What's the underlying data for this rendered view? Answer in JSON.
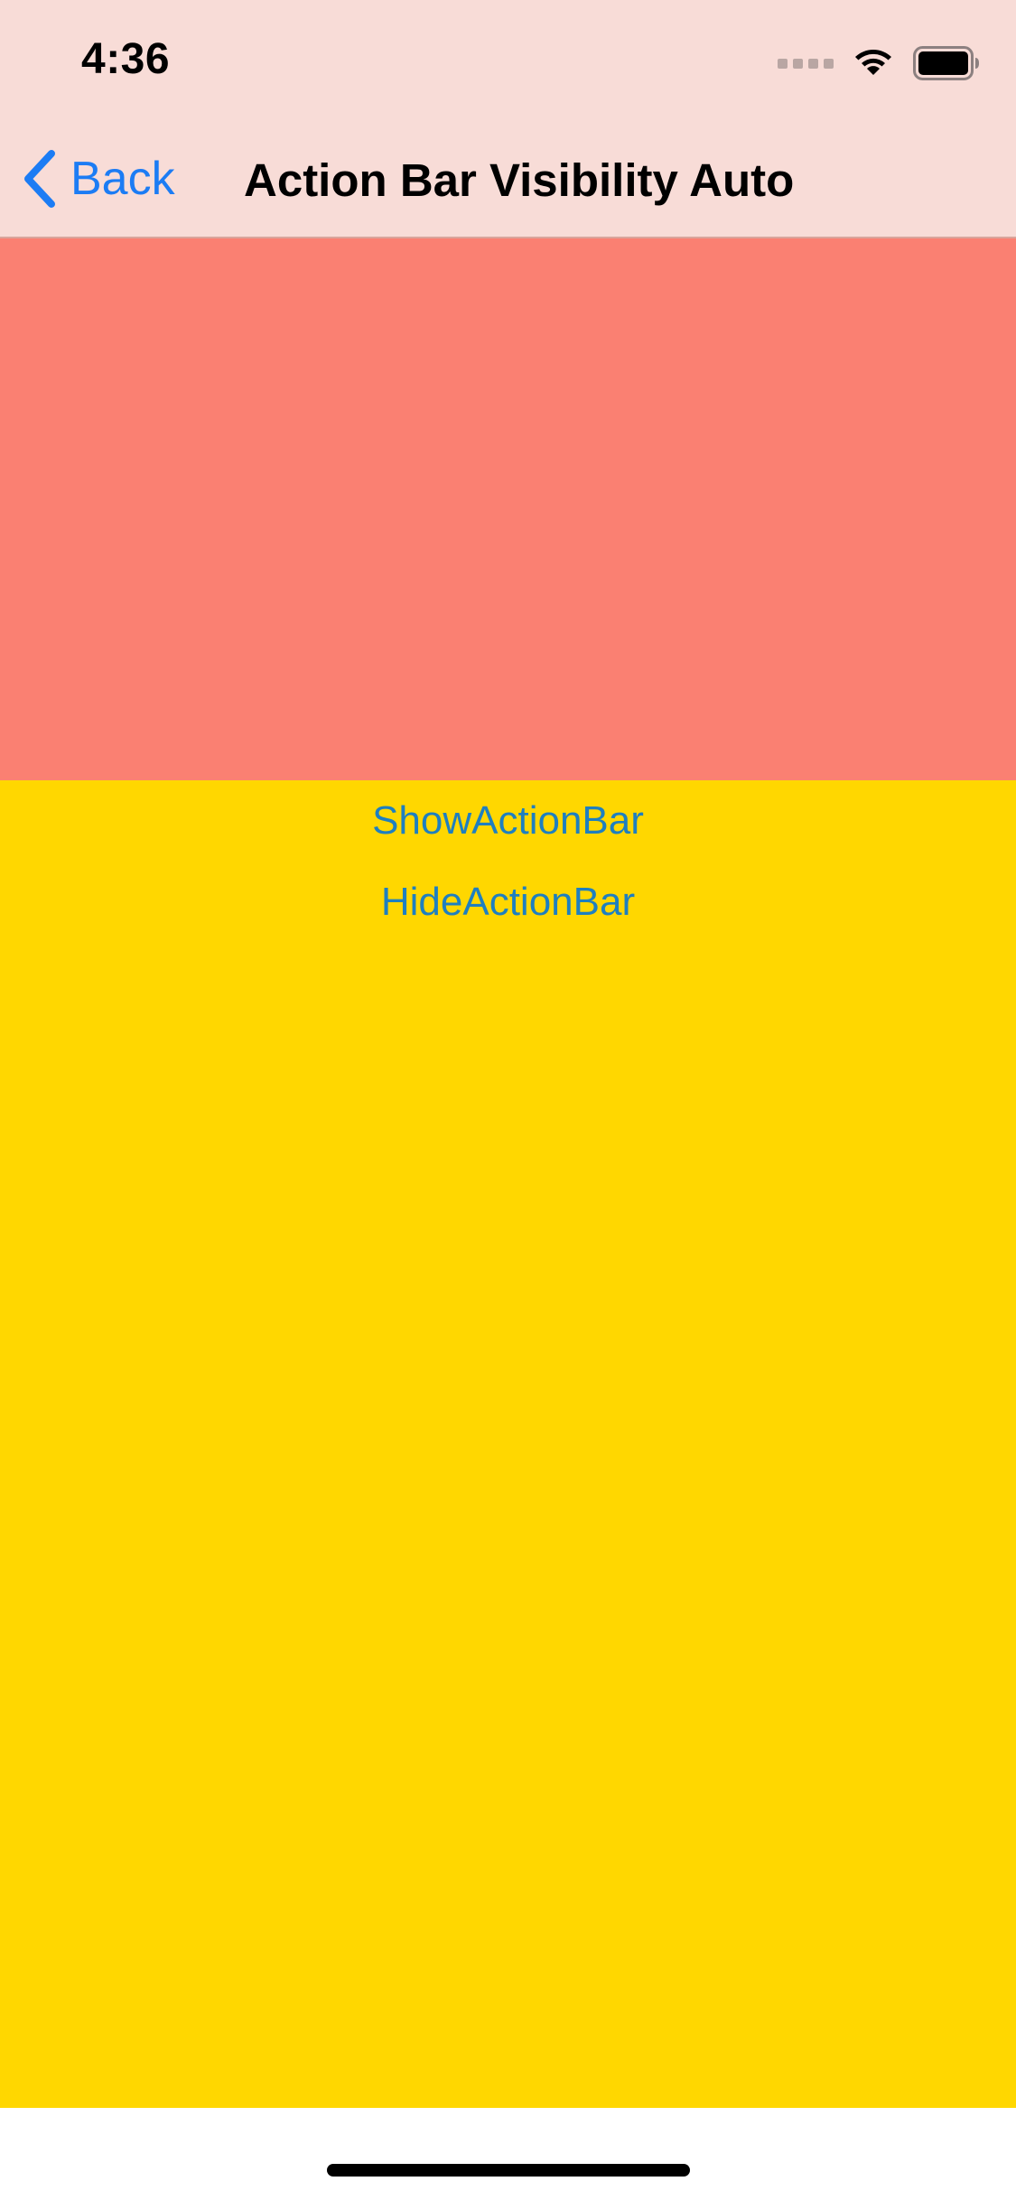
{
  "status_bar": {
    "time": "4:36",
    "icons": [
      "signal-icon",
      "wifi-icon",
      "battery-icon"
    ]
  },
  "nav_bar": {
    "back_label": "Back",
    "title": "Action Bar Visibility Auto",
    "back_icon": "chevron-left-icon"
  },
  "content": {
    "show_action_bar_label": "ShowActionBar",
    "hide_action_bar_label": "HideActionBar"
  },
  "colors": {
    "top_chrome_bg": "#F8DCD7",
    "accent_blue": "#1C7CF4",
    "salmon_block": "#FA8072",
    "gold_block": "#FFD700",
    "link_blue": "#1E7FC0"
  }
}
